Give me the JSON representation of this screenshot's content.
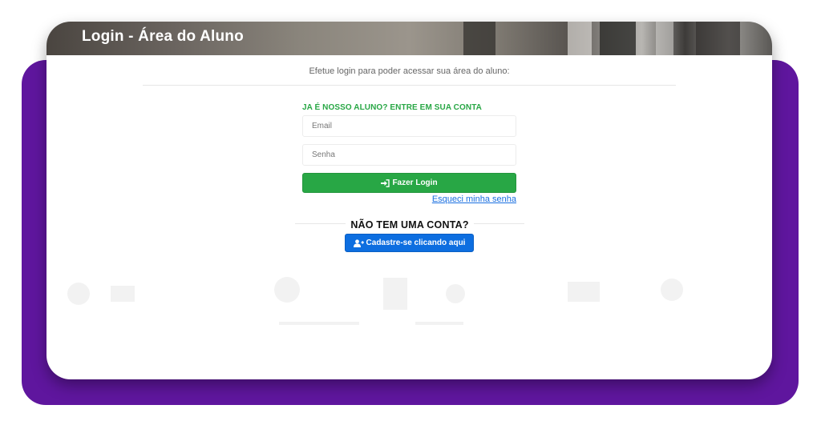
{
  "header": {
    "title": "Login - Área do Aluno"
  },
  "intro": {
    "text": "Efetue login para poder acessar sua área do aluno:"
  },
  "login": {
    "section_label": "JA É NOSSO ALUNO? ENTRE EM SUA CONTA",
    "email_placeholder": "Email",
    "password_placeholder": "Senha",
    "login_button": "Fazer Login",
    "login_icon": "sign-in-icon",
    "forgot_link": "Esqueci minha senha"
  },
  "signup": {
    "heading": "NÃO TEM UMA CONTA?",
    "button": "Cadastre-se clicando aqui",
    "button_icon": "user-plus-icon"
  },
  "colors": {
    "frame_purple": "#5f169e",
    "success_green": "#28a745",
    "primary_blue": "#0d6ee0",
    "link_blue": "#1a6fe0"
  }
}
